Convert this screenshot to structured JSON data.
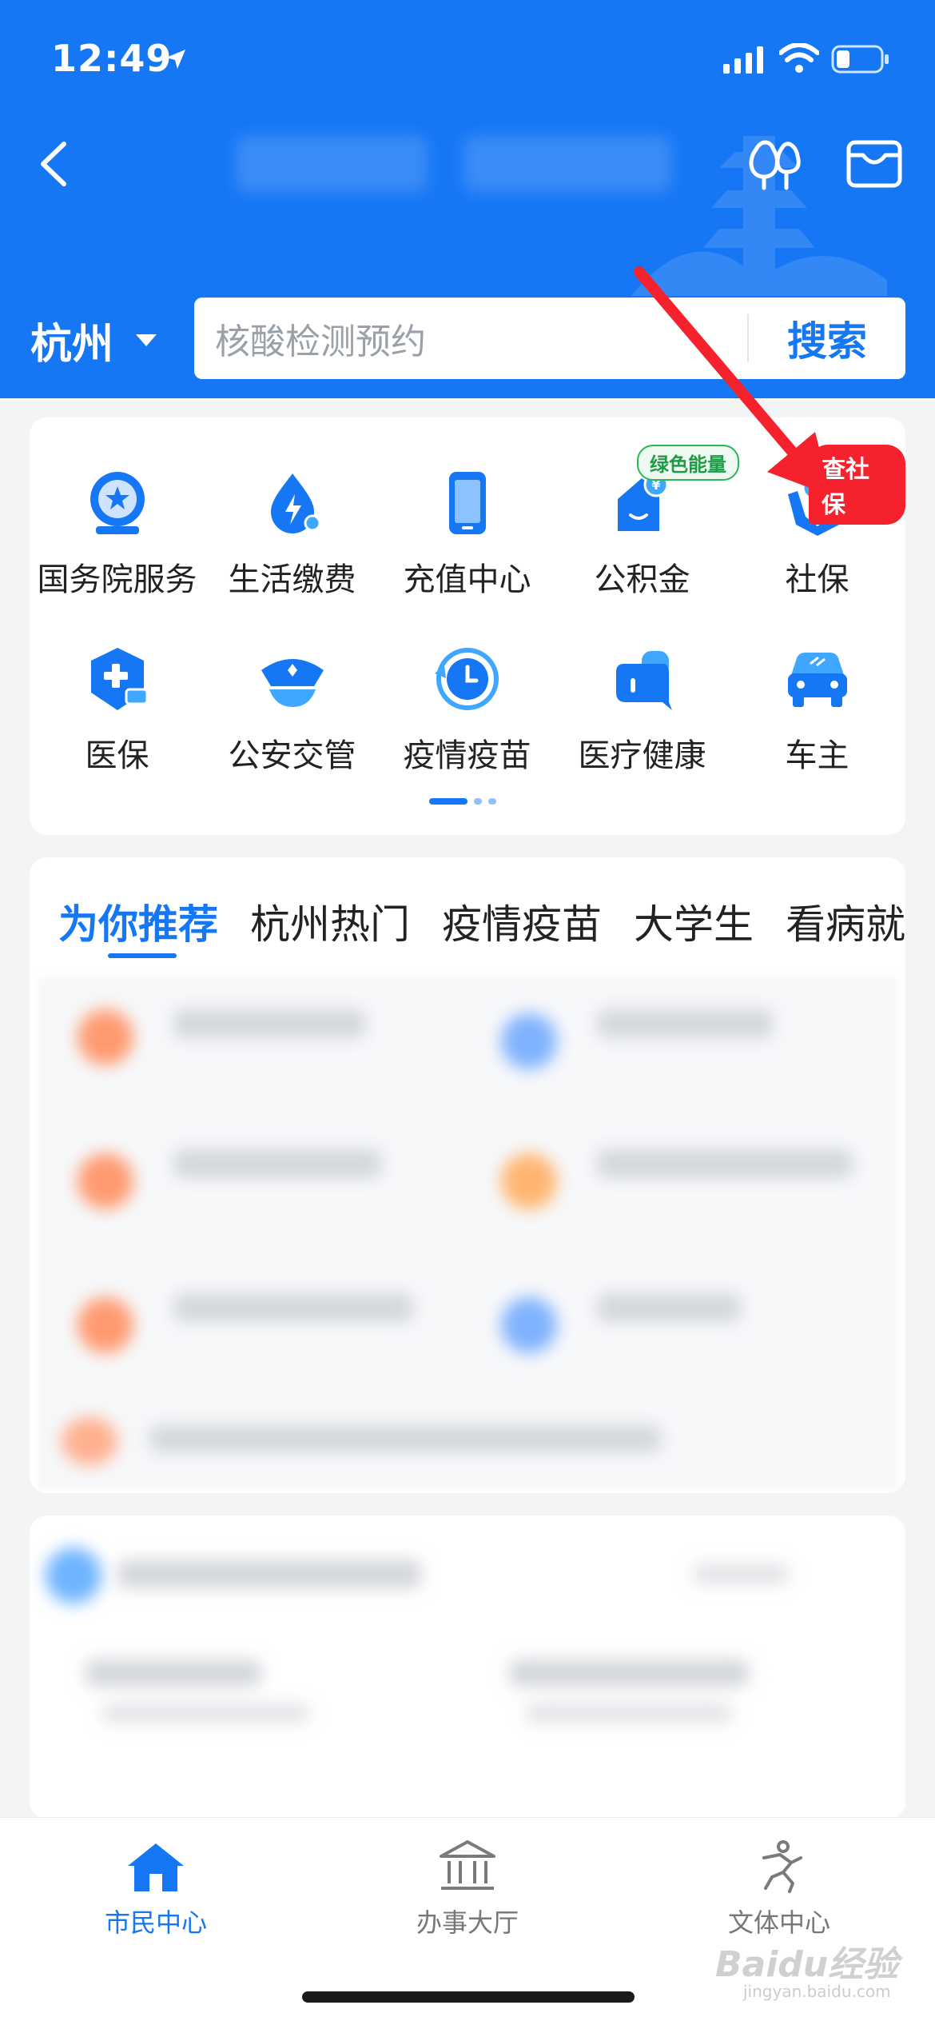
{
  "status_bar": {
    "time": "12:49"
  },
  "header": {
    "city": "杭州",
    "search_placeholder": "核酸检测预约",
    "search_button": "搜索"
  },
  "services": {
    "row1": [
      {
        "label": "国务院服务",
        "icon": "state-council-icon"
      },
      {
        "label": "生活缴费",
        "icon": "utility-bill-icon"
      },
      {
        "label": "充值中心",
        "icon": "phone-recharge-icon"
      },
      {
        "label": "公积金",
        "icon": "housing-fund-icon",
        "badge": "绿色能量"
      },
      {
        "label": "社保",
        "icon": "social-security-icon",
        "badge": "查社保"
      }
    ],
    "row2": [
      {
        "label": "医保",
        "icon": "medical-insurance-icon"
      },
      {
        "label": "公安交管",
        "icon": "police-cap-icon"
      },
      {
        "label": "疫情疫苗",
        "icon": "vaccine-clock-icon"
      },
      {
        "label": "医疗健康",
        "icon": "medical-health-icon"
      },
      {
        "label": "车主",
        "icon": "car-icon"
      }
    ]
  },
  "recommend": {
    "tabs": [
      "为你推荐",
      "杭州热门",
      "疫情疫苗",
      "大学生",
      "看病就"
    ]
  },
  "tabbar": [
    {
      "label": "市民中心",
      "icon": "home-icon",
      "active": true
    },
    {
      "label": "办事大厅",
      "icon": "government-hall-icon",
      "active": false
    },
    {
      "label": "文体中心",
      "icon": "running-person-icon",
      "active": false
    }
  ],
  "watermark": {
    "text": "Baidu经验",
    "sub": "jingyan.baidu.com"
  },
  "colors": {
    "brand": "#1677f5",
    "badge_red": "#f5222d",
    "badge_green": "#2bb657",
    "annotation_arrow": "#f5222d"
  }
}
